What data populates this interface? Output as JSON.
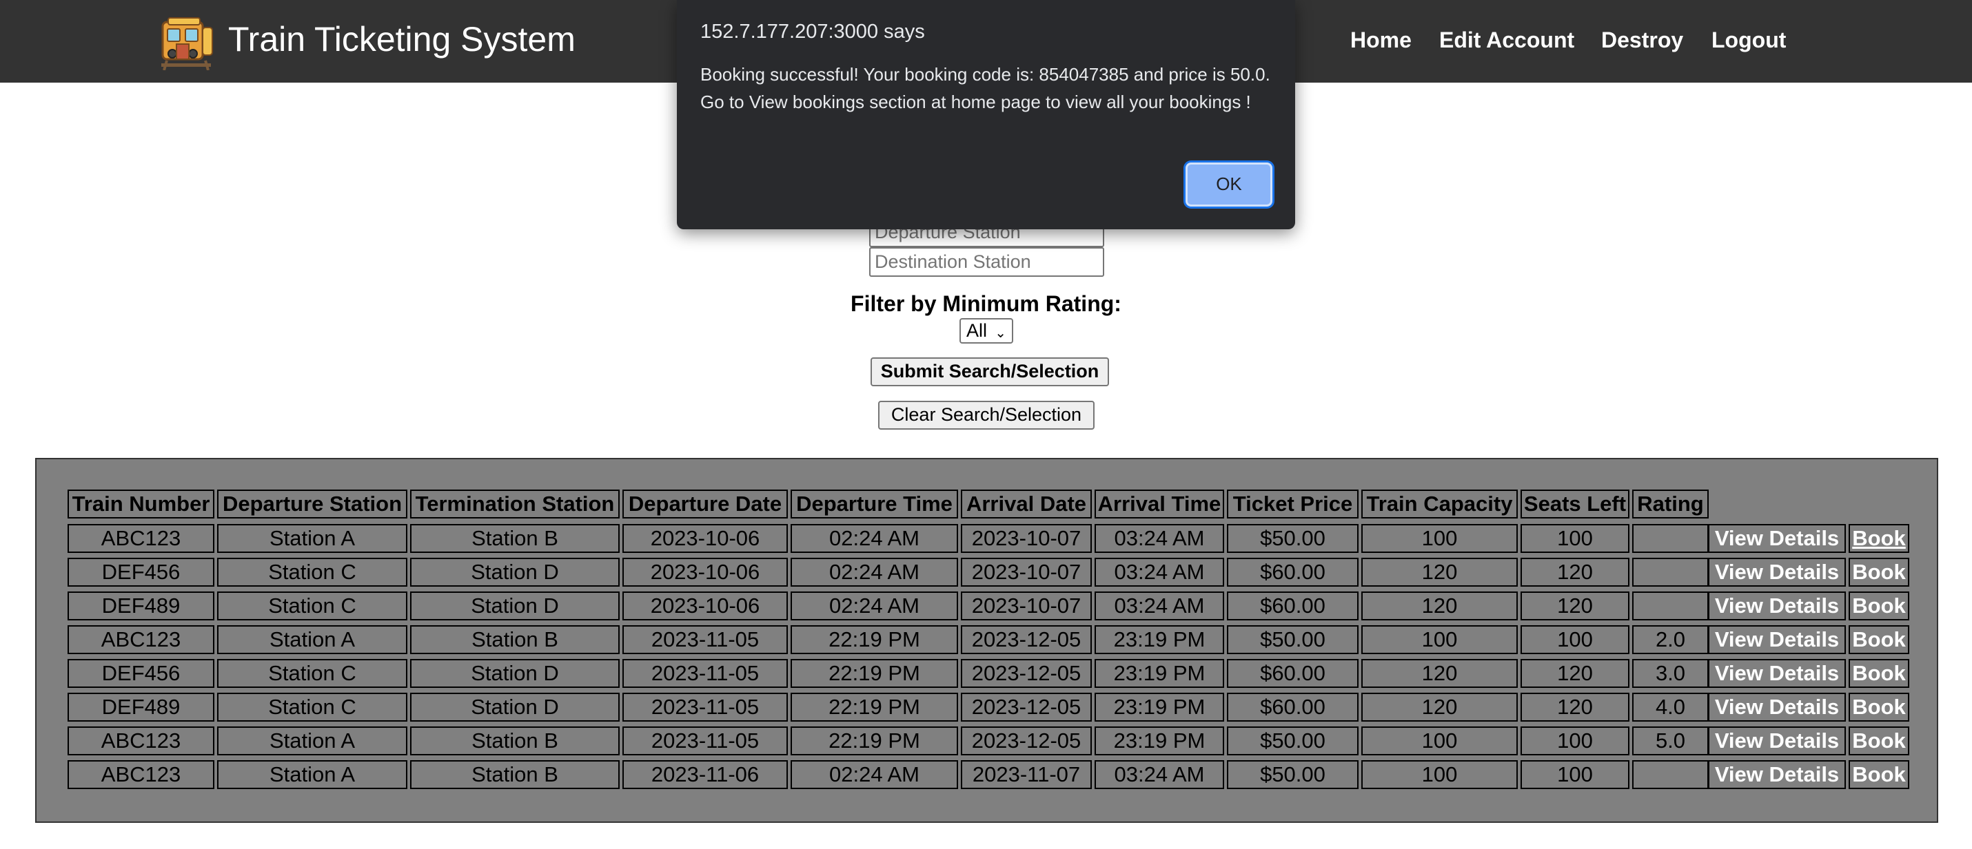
{
  "navbar": {
    "brand": "Train Ticketing System",
    "links": [
      "Home",
      "Edit Account",
      "Destroy",
      "Logout"
    ]
  },
  "search": {
    "departure_placeholder": "Departure Station",
    "destination_placeholder": "Destination Station",
    "filter_label": "Filter by Minimum Rating:",
    "rating_selected": "All",
    "submit_label": "Submit Search/Selection",
    "clear_label": "Clear Search/Selection"
  },
  "table": {
    "headers": [
      "Train Number",
      "Departure Station",
      "Termination Station",
      "Departure Date",
      "Departure Time",
      "Arrival Date",
      "Arrival Time",
      "Ticket Price",
      "Train Capacity",
      "Seats Left",
      "Rating"
    ],
    "view_label": "View Details",
    "book_label": "Book",
    "rows": [
      [
        "ABC123",
        "Station A",
        "Station B",
        "2023-10-06",
        "02:24 AM",
        "2023-10-07",
        "03:24 AM",
        "$50.00",
        "100",
        "100",
        ""
      ],
      [
        "DEF456",
        "Station C",
        "Station D",
        "2023-10-06",
        "02:24 AM",
        "2023-10-07",
        "03:24 AM",
        "$60.00",
        "120",
        "120",
        ""
      ],
      [
        "DEF489",
        "Station C",
        "Station D",
        "2023-10-06",
        "02:24 AM",
        "2023-10-07",
        "03:24 AM",
        "$60.00",
        "120",
        "120",
        ""
      ],
      [
        "ABC123",
        "Station A",
        "Station B",
        "2023-11-05",
        "22:19 PM",
        "2023-12-05",
        "23:19 PM",
        "$50.00",
        "100",
        "100",
        "2.0"
      ],
      [
        "DEF456",
        "Station C",
        "Station D",
        "2023-11-05",
        "22:19 PM",
        "2023-12-05",
        "23:19 PM",
        "$60.00",
        "120",
        "120",
        "3.0"
      ],
      [
        "DEF489",
        "Station C",
        "Station D",
        "2023-11-05",
        "22:19 PM",
        "2023-12-05",
        "23:19 PM",
        "$60.00",
        "120",
        "120",
        "4.0"
      ],
      [
        "ABC123",
        "Station A",
        "Station B",
        "2023-11-05",
        "22:19 PM",
        "2023-12-05",
        "23:19 PM",
        "$50.00",
        "100",
        "100",
        "5.0"
      ],
      [
        "ABC123",
        "Station A",
        "Station B",
        "2023-11-06",
        "02:24 AM",
        "2023-11-07",
        "03:24 AM",
        "$50.00",
        "100",
        "100",
        ""
      ]
    ]
  },
  "dialog": {
    "title": "152.7.177.207:3000 says",
    "message_lines": [
      "Booking successful! Your booking code is: 854047385 and price is 50.0.",
      "Go to View bookings section at home page to view all your bookings !"
    ],
    "ok_label": "OK"
  },
  "colors": {
    "navbar_bg": "#333333",
    "table_panel_bg": "#808080",
    "dialog_bg": "#292a2d",
    "ok_button": "#8ab4f8"
  },
  "icons": {
    "logo": "train-logo-icon",
    "select_arrow": "chevron-down-icon"
  }
}
